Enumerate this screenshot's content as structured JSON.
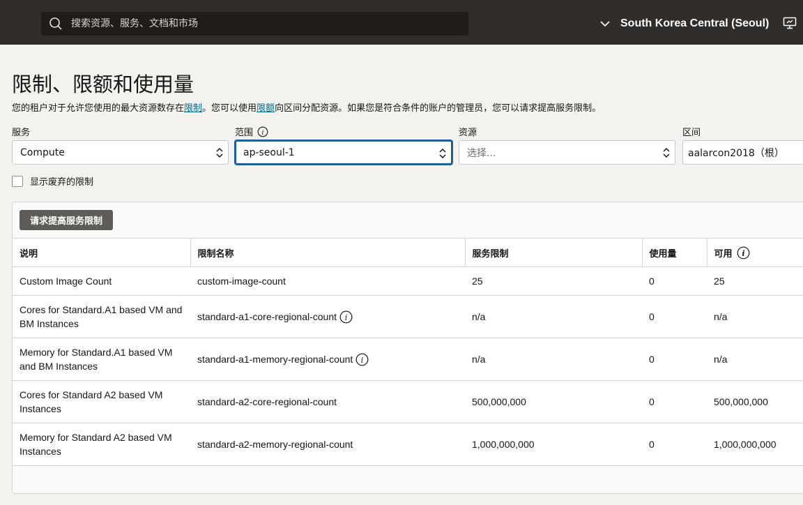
{
  "header": {
    "search_placeholder": "搜索资源、服务、文档和市场",
    "region": "South Korea Central (Seoul)"
  },
  "page": {
    "title": "限制、限额和使用量",
    "desc_part1": "您的租户对于允许您使用的最大资源数存在",
    "desc_link1": "限制",
    "desc_part2": "。您可以使用",
    "desc_link2": "限额",
    "desc_part3": "向区间分配资源。如果您是符合条件的账户的管理员，您可以请求提高服务限制。"
  },
  "filters": {
    "service_label": "服务",
    "service_value": "Compute",
    "scope_label": "范围",
    "scope_value": "ap-seoul-1",
    "resource_label": "资源",
    "resource_placeholder": "选择...",
    "compartment_label": "区间",
    "compartment_value": "aalarcon2018（根）",
    "deprecated_label": "显示废弃的限制"
  },
  "panel": {
    "request_button": "请求提高服务限制"
  },
  "table": {
    "columns": [
      "说明",
      "限制名称",
      "服务限制",
      "使用量",
      "可用"
    ],
    "rows": [
      {
        "desc": "Custom Image Count",
        "name": "custom-image-count",
        "limit": "25",
        "usage": "0",
        "available": "25"
      },
      {
        "desc": "Cores for Standard.A1 based VM and BM Instances",
        "name": "standard-a1-core-regional-count",
        "limit": "n/a",
        "usage": "0",
        "available": "n/a"
      },
      {
        "desc": "Memory for Standard.A1 based VM and BM Instances",
        "name": "standard-a1-memory-regional-count",
        "limit": "n/a",
        "usage": "0",
        "available": "n/a"
      },
      {
        "desc": "Cores for Standard A2 based VM Instances",
        "name": "standard-a2-core-regional-count",
        "limit": "500,000,000",
        "usage": "0",
        "available": "500,000,000"
      },
      {
        "desc": "Memory for Standard A2 based VM Instances",
        "name": "standard-a2-memory-regional-count",
        "limit": "1,000,000,000",
        "usage": "0",
        "available": "1,000,000,000"
      }
    ]
  },
  "colors": {
    "topbar": "#312d2a",
    "button": "#5f5b57",
    "link": "#00688c"
  },
  "icons": [
    "search-icon",
    "chevron-down-icon",
    "monitor-icon",
    "info-icon",
    "updown-arrows-icon"
  ]
}
